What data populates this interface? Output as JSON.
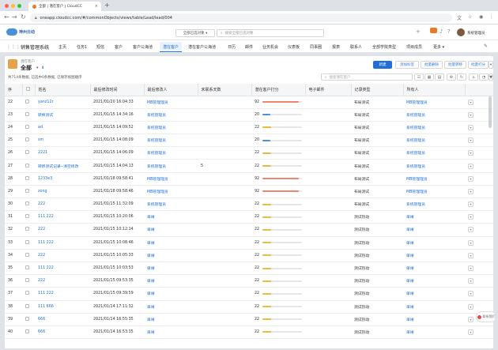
{
  "browser": {
    "tab_title": "全部 | 潜在客户 | CloudCC",
    "tab_close": "×",
    "new_tab": "+",
    "url": "oneapp.cloudcc.com/#/commonObjects/views/table/Lead/lead/004"
  },
  "header": {
    "logo_text": "神州云动",
    "global_select": "全部已选对象",
    "global_search_placeholder": "搜索全部已选对象",
    "user_name": "系统管理员"
  },
  "nav": {
    "app_name": "销售管理系统",
    "items": [
      "主页",
      "任务1",
      "短信",
      "客户",
      "客户公海池",
      "潜在客户",
      "潜在客户公海池",
      "日历",
      "邮件",
      "业务机会",
      "仪表板",
      "同事圈",
      "报表",
      "联系人",
      "全部学院类型",
      "项目成员",
      "更多"
    ],
    "active_index": 5
  },
  "list": {
    "object_name": "潜在客户",
    "view_name": "全部",
    "summary": "共714条数据, 已选中0条数据, 已保存视图顺序",
    "search_placeholder": "搜索潜在客户",
    "buttons": [
      "新建",
      "添加标签",
      "批量删除",
      "批量转移",
      "批量打分"
    ],
    "columns": [
      "",
      "",
      "姓名",
      "最后修改时间",
      "最后修改人",
      "未联系天数",
      "潜在客户打分",
      "电子邮件",
      "记录类型",
      "所有人",
      ""
    ]
  },
  "rows": [
    {
      "no": "22",
      "name": "yanz12r",
      "time": "2021/01/20 16:04:33",
      "modifier": "MB管理理员",
      "days": "",
      "score": 92,
      "email": "",
      "type": "布局测试",
      "owner": "MB管理理员"
    },
    {
      "no": "23",
      "name": "转换测试",
      "time": "2021/01/15 14:34:16",
      "modifier": "系统管理员",
      "days": "",
      "score": 20,
      "email": "",
      "type": "布局测试",
      "owner": "系统管理员"
    },
    {
      "no": "24",
      "name": "ad",
      "time": "2021/01/15 14:09:52",
      "modifier": "系统管理员",
      "days": "",
      "score": 22,
      "email": "",
      "type": "布局测试",
      "owner": "系统管理员"
    },
    {
      "no": "25",
      "name": "sm",
      "time": "2021/01/15 14:08:09",
      "modifier": "系统管理员",
      "days": "",
      "score": 20,
      "email": "",
      "type": "布局测试",
      "owner": "系统管理员"
    },
    {
      "no": "26",
      "name": "2221",
      "time": "2021/01/15 14:06:09",
      "modifier": "系统管理员",
      "days": "",
      "score": 22,
      "email": "",
      "type": "布局测试",
      "owner": "系统管理员"
    },
    {
      "no": "27",
      "name": "转移测试记录--清空修改",
      "time": "2021/01/15 14:04:13",
      "modifier": "系统管理员",
      "days": "5",
      "score": 22,
      "email": "",
      "type": "布局测试",
      "owner": "系统管理员"
    },
    {
      "no": "28",
      "name": "1233e3",
      "time": "2021/01/18 09:58:41",
      "modifier": "MB管理理员",
      "days": "",
      "score": 92,
      "email": "",
      "type": "布局测试",
      "owner": "MB管理理员"
    },
    {
      "no": "29",
      "name": "zong",
      "time": "2021/01/18 09:58:46",
      "modifier": "MB管理理员",
      "days": "",
      "score": 92,
      "email": "",
      "type": "布局测试",
      "owner": "MB管理理员"
    },
    {
      "no": "30",
      "name": "222",
      "time": "2021/01/15 11:32:09",
      "modifier": "系统管理员",
      "days": "",
      "score": 22,
      "email": "",
      "type": "布局测试",
      "owner": "系统管理员"
    },
    {
      "no": "31",
      "name": "111 222",
      "time": "2021/01/15 10:20:06",
      "modifier": "单靖",
      "days": "",
      "score": 22,
      "email": "",
      "type": "测试热动",
      "owner": "单靖"
    },
    {
      "no": "32",
      "name": "222",
      "time": "2021/01/15 10:12:14",
      "modifier": "单靖",
      "days": "",
      "score": 22,
      "email": "",
      "type": "测试热动",
      "owner": "单靖"
    },
    {
      "no": "33",
      "name": "111 222",
      "time": "2021/01/15 10:08:46",
      "modifier": "单靖",
      "days": "",
      "score": 22,
      "email": "",
      "type": "测试热动",
      "owner": "单靖"
    },
    {
      "no": "34",
      "name": "222",
      "time": "2021/01/15 10:05:33",
      "modifier": "单靖",
      "days": "",
      "score": 22,
      "email": "",
      "type": "测试热动",
      "owner": "单靖"
    },
    {
      "no": "35",
      "name": "111 222",
      "time": "2021/01/15 10:03:53",
      "modifier": "单靖",
      "days": "",
      "score": 22,
      "email": "",
      "type": "测试热动",
      "owner": "单靖"
    },
    {
      "no": "36",
      "name": "222",
      "time": "2021/01/15 09:53:35",
      "modifier": "单靖",
      "days": "",
      "score": 22,
      "email": "",
      "type": "测试热动",
      "owner": "单靖"
    },
    {
      "no": "37",
      "name": "111 222",
      "time": "2021/01/15 09:39:59",
      "modifier": "单靖",
      "days": "",
      "score": 22,
      "email": "",
      "type": "测试热动",
      "owner": "单靖"
    },
    {
      "no": "38",
      "name": "111 666",
      "time": "2021/01/14 17:11:32",
      "modifier": "单靖",
      "days": "",
      "score": 22,
      "email": "",
      "type": "测试热动",
      "owner": "单靖"
    },
    {
      "no": "39",
      "name": "666",
      "time": "2021/01/14 16:55:35",
      "modifier": "单靖",
      "days": "",
      "score": 22,
      "email": "",
      "type": "测试热动",
      "owner": "单靖"
    },
    {
      "no": "40",
      "name": "666",
      "time": "2021/01/14 16:53:35",
      "modifier": "单靖",
      "days": "",
      "score": 22,
      "email": "",
      "type": "测试热动",
      "owner": "单靖"
    }
  ],
  "float_help": "联系我们",
  "colors": {
    "accent": "#1f6fd6",
    "score_high": "#f0856b",
    "score_mid": "#4a8fe0",
    "score_low": "#f3b63f"
  }
}
